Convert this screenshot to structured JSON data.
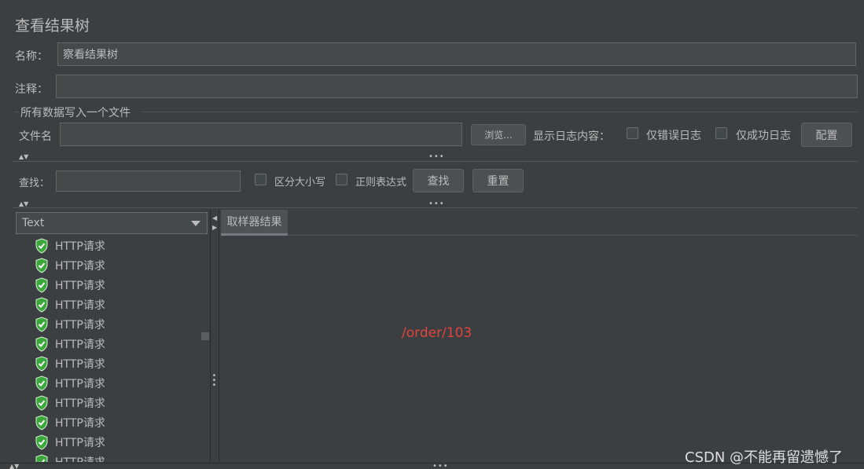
{
  "panel": {
    "title": "查看结果树",
    "name_label": "名称：",
    "name_value": "察看结果树",
    "comment_label": "注释：",
    "comment_value": ""
  },
  "file_group": {
    "title": "所有数据写入一个文件",
    "filename_label": "文件名",
    "filename_value": "",
    "browse_label": "浏览...",
    "log_content_label": "显示日志内容：",
    "errors_only_label": "仅错误日志",
    "success_only_label": "仅成功日志",
    "configure_label": "配置"
  },
  "search": {
    "label": "查找：",
    "value": "",
    "case_sensitive_label": "区分大小写",
    "regex_label": "正则表达式",
    "find_label": "查找",
    "reset_label": "重置"
  },
  "tree": {
    "renderer_selected": "Text",
    "items": [
      {
        "label": "HTTP请求",
        "status": "success"
      },
      {
        "label": "HTTP请求",
        "status": "success"
      },
      {
        "label": "HTTP请求",
        "status": "success"
      },
      {
        "label": "HTTP请求",
        "status": "success"
      },
      {
        "label": "HTTP请求",
        "status": "success"
      },
      {
        "label": "HTTP请求",
        "status": "success"
      },
      {
        "label": "HTTP请求",
        "status": "success"
      },
      {
        "label": "HTTP请求",
        "status": "success"
      },
      {
        "label": "HTTP请求",
        "status": "success"
      },
      {
        "label": "HTTP请求",
        "status": "success"
      },
      {
        "label": "HTTP请求",
        "status": "success"
      },
      {
        "label": "HTTP请求",
        "status": "success"
      }
    ]
  },
  "result": {
    "tab_label": "取样器结果",
    "content": "/order/103"
  },
  "watermark": "CSDN @不能再留遗憾了",
  "colors": {
    "background": "#3c3f41",
    "input_bg": "#45494a",
    "text": "#bbbbbb",
    "accent_red": "#e0443e",
    "success_green": "#3aa83a"
  }
}
